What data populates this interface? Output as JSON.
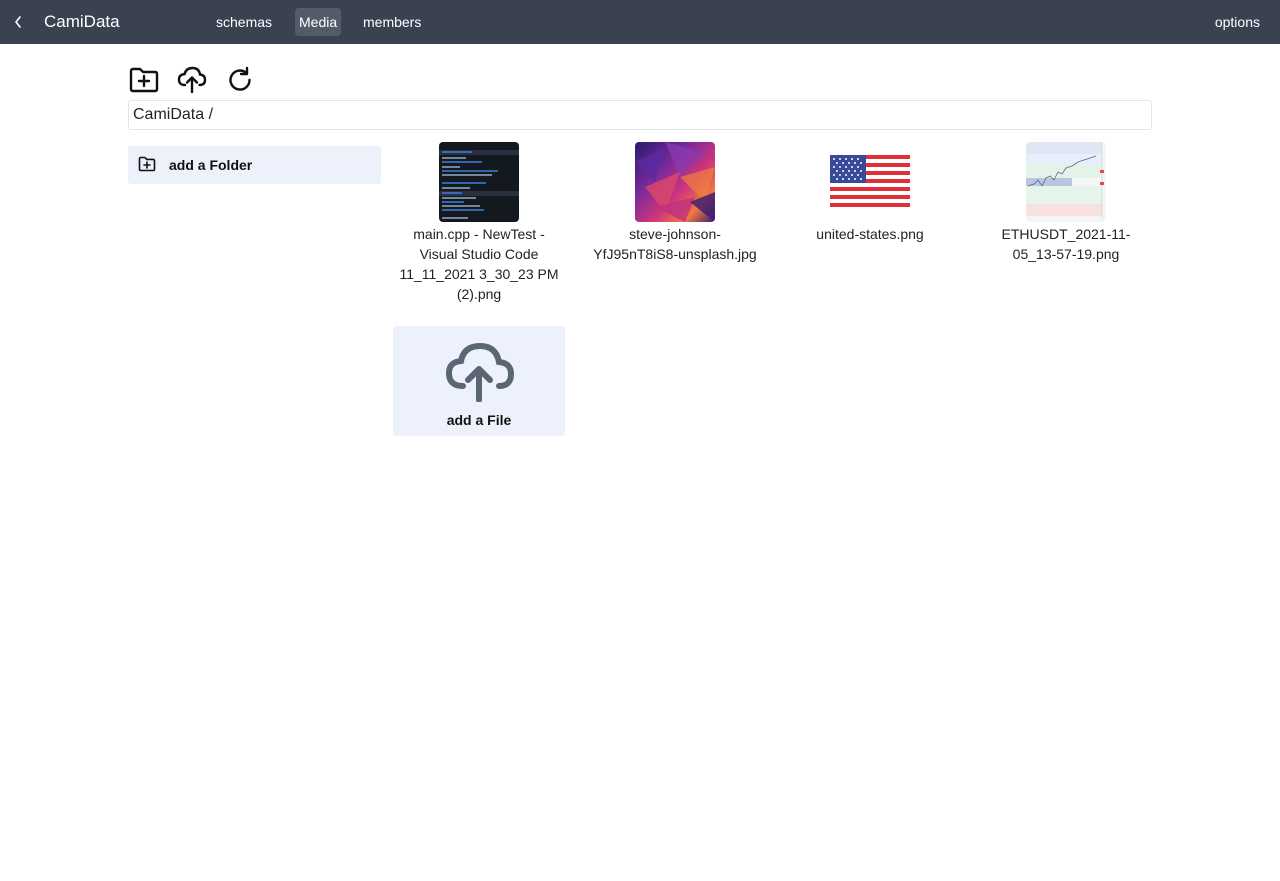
{
  "header": {
    "title": "CamiData",
    "tabs": [
      {
        "label": "schemas"
      },
      {
        "label": "Media"
      },
      {
        "label": "members"
      }
    ],
    "options_label": "options"
  },
  "toolbar": {
    "new_folder_icon": "folder-plus-icon",
    "upload_icon": "cloud-upload-icon",
    "refresh_icon": "refresh-icon"
  },
  "breadcrumb": "CamiData /",
  "sidebar": {
    "add_folder_label": "add a Folder"
  },
  "files": [
    {
      "name": "main.cpp - NewTest - Visual Studio Code 11_11_2021 3_30_23 PM (2).png"
    },
    {
      "name": "steve-johnson-YfJ95nT8iS8-unsplash.jpg"
    },
    {
      "name": "united-states.png"
    },
    {
      "name": "ETHUSDT_2021-11-05_13-57-19.png"
    }
  ],
  "add_file": {
    "label": "add a File"
  },
  "colors": {
    "header_bg": "#3a4252",
    "active_tab_bg": "#535b6b",
    "panel_bg": "#edf1fb",
    "upload_icon": "#5b6674"
  }
}
